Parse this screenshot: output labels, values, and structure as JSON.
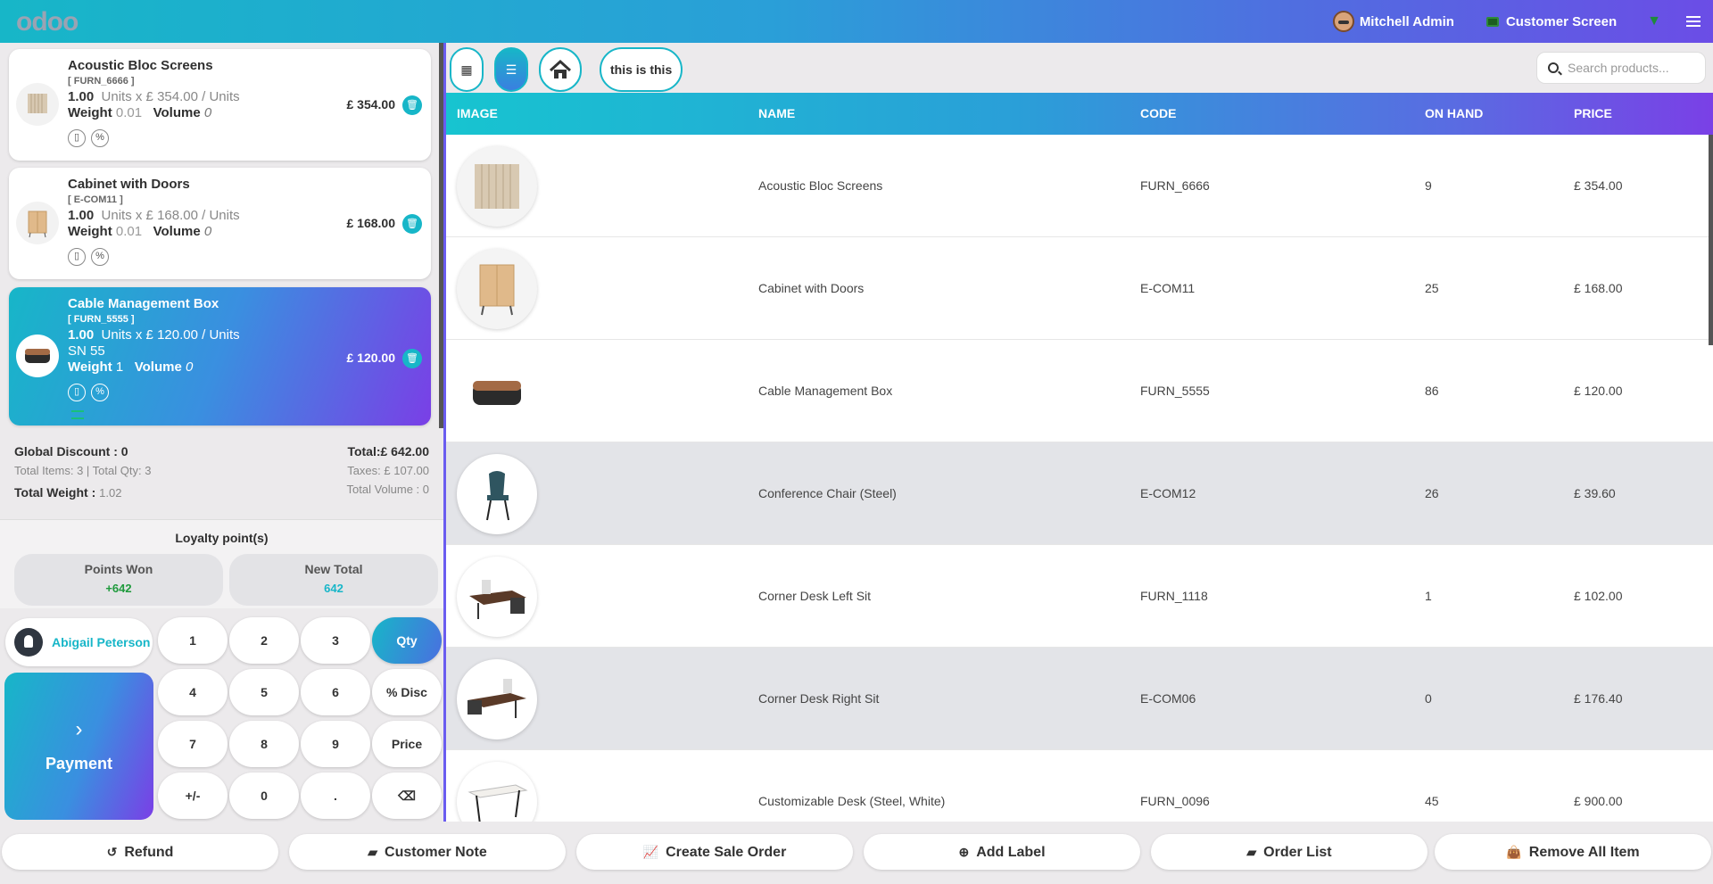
{
  "topbar": {
    "logo": "odoo",
    "user_name": "Mitchell Admin",
    "customer_screen": "Customer Screen"
  },
  "orderlines": [
    {
      "name": "Acoustic Bloc Screens",
      "code": "[ FURN_6666 ]",
      "qty": "1.00",
      "unit_text": "Units x £ 354.00 / Units",
      "weight_label": "Weight",
      "weight": "0.01",
      "volume_label": "Volume",
      "volume": "0",
      "price": "£ 354.00"
    },
    {
      "name": "Cabinet with Doors",
      "code": "[ E-COM11 ]",
      "qty": "1.00",
      "unit_text": "Units x £ 168.00 / Units",
      "weight_label": "Weight",
      "weight": "0.01",
      "volume_label": "Volume",
      "volume": "0",
      "price": "£ 168.00"
    },
    {
      "name": "Cable Management Box",
      "code": "[ FURN_5555 ]",
      "qty": "1.00",
      "unit_text": "Units x £ 120.00 / Units",
      "sn": "SN 55",
      "weight_label": "Weight",
      "weight": "1",
      "volume_label": "Volume",
      "volume": "0",
      "price": "£ 120.00"
    }
  ],
  "summary": {
    "global_discount": "Global Discount : 0",
    "total_items": "Total Items: 3  |  Total Qty: 3",
    "total_weight_label": "Total Weight :",
    "total_weight": "1.02",
    "total": "Total:£ 642.00",
    "taxes": "Taxes: £ 107.00",
    "total_volume": "Total Volume : 0"
  },
  "loyalty": {
    "title": "Loyalty point(s)",
    "points_won_label": "Points Won",
    "points_won": "+642",
    "new_total_label": "New Total",
    "new_total": "642"
  },
  "numpad": {
    "customer": "Abigail Peterson",
    "payment": "Payment",
    "keys": [
      "1",
      "2",
      "3",
      "Qty",
      "4",
      "5",
      "6",
      "% Disc",
      "7",
      "8",
      "9",
      "Price",
      "+/-",
      "0",
      ".",
      "⌫"
    ]
  },
  "controls": {
    "tag": "this is this",
    "search_placeholder": "Search products..."
  },
  "table": {
    "headers": [
      "IMAGE",
      "NAME",
      "CODE",
      "ON HAND",
      "PRICE"
    ],
    "rows": [
      {
        "name": "Acoustic Bloc Screens",
        "code": "FURN_6666",
        "on_hand": "9",
        "price": "£ 354.00"
      },
      {
        "name": "Cabinet with Doors",
        "code": "E-COM11",
        "on_hand": "25",
        "price": "£ 168.00"
      },
      {
        "name": "Cable Management Box",
        "code": "FURN_5555",
        "on_hand": "86",
        "price": "£ 120.00"
      },
      {
        "name": "Conference Chair (Steel)",
        "code": "E-COM12",
        "on_hand": "26",
        "price": "£ 39.60"
      },
      {
        "name": "Corner Desk Left Sit",
        "code": "FURN_1118",
        "on_hand": "1",
        "price": "£ 102.00"
      },
      {
        "name": "Corner Desk Right Sit",
        "code": "E-COM06",
        "on_hand": "0",
        "price": "£ 176.40"
      },
      {
        "name": "Customizable Desk (Steel, White)",
        "code": "FURN_0096",
        "on_hand": "45",
        "price": "£ 900.00"
      }
    ]
  },
  "bottom": [
    "Refund",
    "Customer Note",
    "Create Sale Order",
    "Add Label",
    "Order List",
    "Remove All Item"
  ],
  "colors": {
    "accent": "#17b6c8",
    "accent2": "#7a3fe6",
    "points_green": "#1e9a3c"
  }
}
